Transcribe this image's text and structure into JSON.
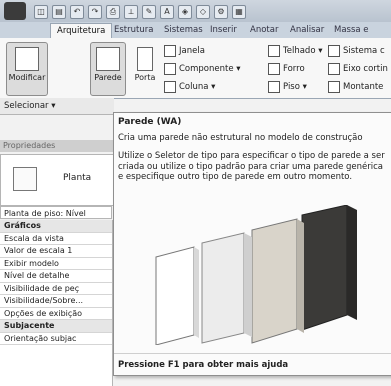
{
  "ribbon": {
    "tabs": [
      "Arquitetura",
      "Estrutura",
      "Sistemas",
      "Inserir",
      "Anotar",
      "Analisar",
      "Massa e terreno"
    ],
    "buttons": {
      "modify": "Modificar",
      "wall": "Parede",
      "door": "Porta",
      "window": "Janela",
      "component": "Componente",
      "column": "Coluna",
      "roof": "Telhado",
      "ceiling": "Forro",
      "floor": "Piso",
      "curtain_system": "Sistema c",
      "curtain_grid": "Eixo cortin",
      "mullion": "Montante"
    }
  },
  "left_panel": {
    "select_label": "Selecionar ▾",
    "properties_header": "Propriedades",
    "type_name": "Planta",
    "view_selector": "Planta de piso: Nível",
    "rows": [
      {
        "label": "Gráficos",
        "group": true
      },
      {
        "label": "Escala da vista",
        "group": false
      },
      {
        "label": "Valor de escala   1",
        "group": false
      },
      {
        "label": "Exibir modelo",
        "group": false
      },
      {
        "label": "Nível de detalhe",
        "group": false
      },
      {
        "label": "Visibilidade de peç",
        "group": false
      },
      {
        "label": "Visibilidade/Sobre...",
        "group": false
      },
      {
        "label": "Opções de exibição",
        "group": false
      },
      {
        "label": "Subjacente",
        "group": true
      },
      {
        "label": "Orientação subjac",
        "group": false
      }
    ]
  },
  "tooltip": {
    "title": "Parede (WA)",
    "description": "Cria uma parede não estrutural no modelo de construção",
    "body": "Utilize o Seletor de tipo para especificar o tipo de parede a ser criada ou utilize o tipo padrão para criar uma parede genérica e especifique outro tipo de parede em outro momento.",
    "footer": "Pressione F1 para obter mais ajuda"
  },
  "colors": {
    "brick": "#d9d4ca",
    "dark_brick": "#3b3a38",
    "concrete": "#ececec"
  }
}
